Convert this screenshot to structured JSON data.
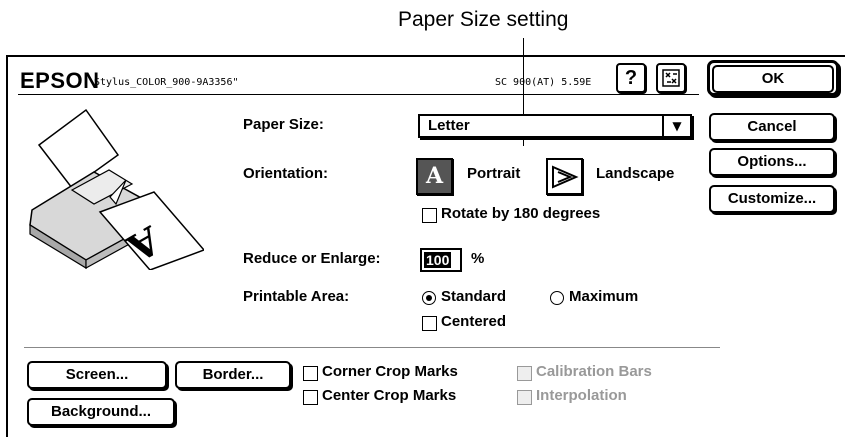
{
  "callout": "Paper Size setting",
  "header": {
    "brand": "EPSON",
    "model": "Stylus_COLOR_900-9A3356\"",
    "version": "SC 900(AT) 5.59E",
    "help_icon": "question-mark-icon",
    "utility_icon": "printer-utility-icon"
  },
  "buttons": {
    "ok": "OK",
    "cancel": "Cancel",
    "options": "Options...",
    "customize": "Customize...",
    "screen": "Screen...",
    "border": "Border...",
    "background": "Background..."
  },
  "paper_size": {
    "label": "Paper Size:",
    "value": "Letter"
  },
  "orientation": {
    "label": "Orientation:",
    "portrait": "Portrait",
    "landscape": "Landscape",
    "selected": "Portrait",
    "rotate_label": "Rotate by 180 degrees",
    "rotate_checked": false
  },
  "scale": {
    "label": "Reduce or Enlarge:",
    "value": "100",
    "unit": "%"
  },
  "printable_area": {
    "label": "Printable Area:",
    "standard": "Standard",
    "maximum": "Maximum",
    "selected": "Standard",
    "centered_label": "Centered",
    "centered_checked": false
  },
  "marks": {
    "corner_crop": "Corner Crop Marks",
    "center_crop": "Center Crop Marks",
    "calibration_bars": "Calibration Bars",
    "interpolation": "Interpolation"
  }
}
